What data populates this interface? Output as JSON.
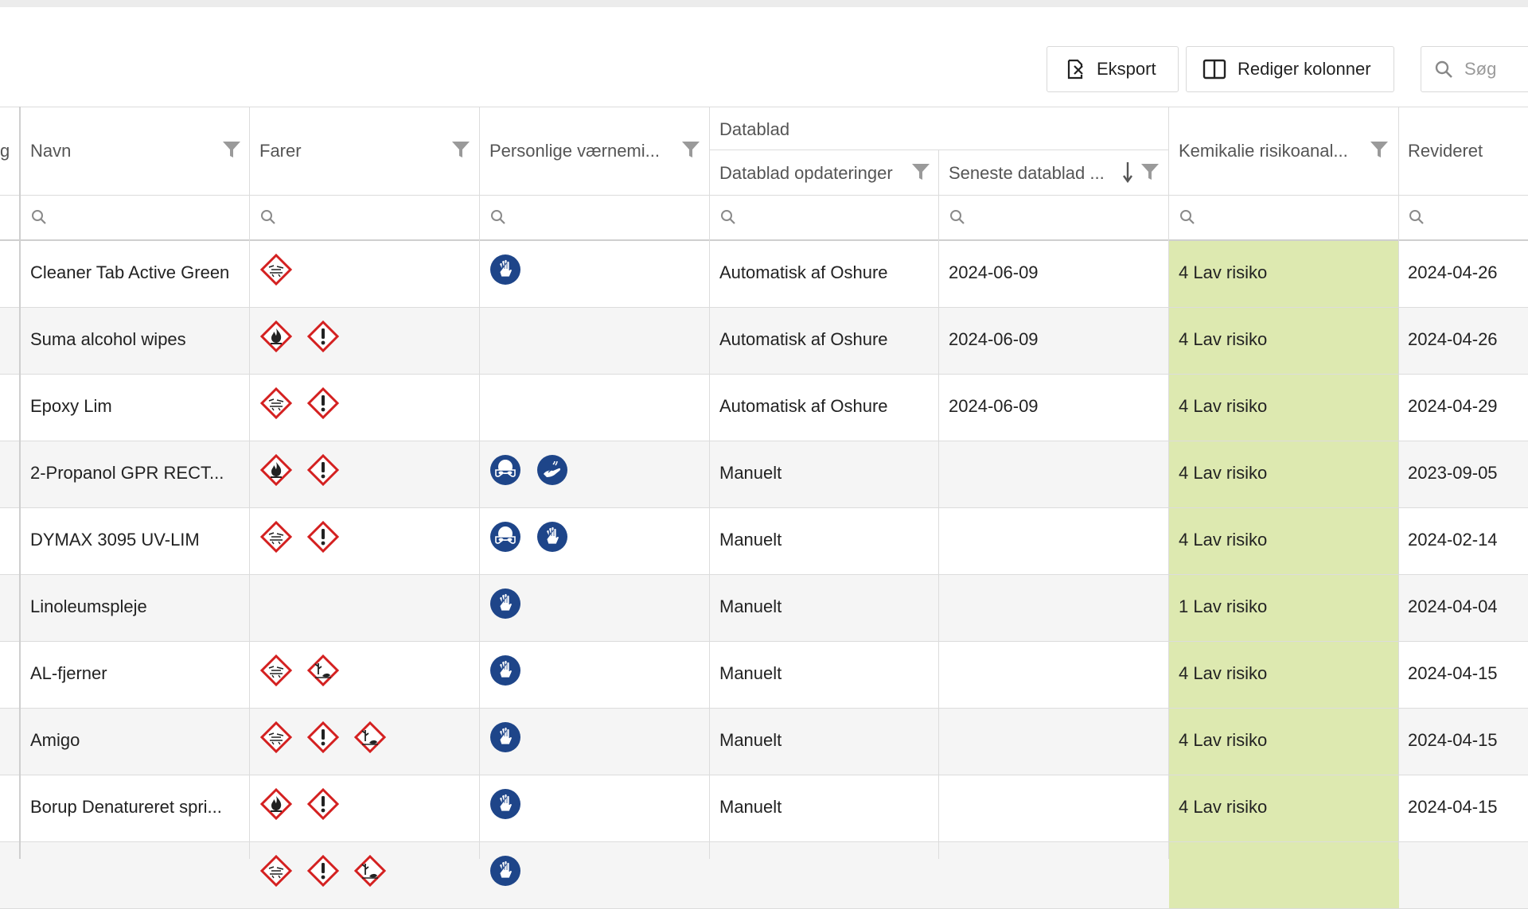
{
  "toolbar": {
    "export_label": "Eksport",
    "columns_label": "Rediger kolonner",
    "search_placeholder": "Søg"
  },
  "columns": {
    "partial_label": "g",
    "name": "Navn",
    "hazards": "Farer",
    "ppe": "Personlige værnemi...",
    "datasheet_group": "Datablad",
    "datasheet_updates": "Datablad opdateringer",
    "latest_datasheet": "Seneste datablad ...",
    "risk": "Kemikalie risikoanal...",
    "revised": "Revideret"
  },
  "colors": {
    "risk_bg": "#dde9b0",
    "hazard_red": "#d42020",
    "ppe_blue": "#1e4589"
  },
  "rows": [
    {
      "name": "Cleaner Tab Active Green",
      "hazards": [
        "corrosive-icon"
      ],
      "ppe": [
        "gloves-icon"
      ],
      "updates": "Automatisk af Oshure",
      "latest": "2024-06-09",
      "risk": "4 Lav risiko",
      "revised": "2024-04-26"
    },
    {
      "name": "Suma alcohol wipes",
      "hazards": [
        "flammable-icon",
        "exclamation-icon"
      ],
      "ppe": [],
      "updates": "Automatisk af Oshure",
      "latest": "2024-06-09",
      "risk": "4 Lav risiko",
      "revised": "2024-04-26"
    },
    {
      "name": "Epoxy Lim",
      "hazards": [
        "corrosive-icon",
        "exclamation-icon"
      ],
      "ppe": [],
      "updates": "Automatisk af Oshure",
      "latest": "2024-06-09",
      "risk": "4 Lav risiko",
      "revised": "2024-04-29"
    },
    {
      "name": "2-Propanol GPR RECT...",
      "hazards": [
        "flammable-icon",
        "exclamation-icon"
      ],
      "ppe": [
        "goggles-icon",
        "hand-wash-icon"
      ],
      "updates": "Manuelt",
      "latest": "",
      "risk": "4 Lav risiko",
      "revised": "2023-09-05"
    },
    {
      "name": "DYMAX 3095 UV-LIM",
      "hazards": [
        "corrosive-icon",
        "exclamation-icon"
      ],
      "ppe": [
        "goggles-icon",
        "gloves-icon"
      ],
      "updates": "Manuelt",
      "latest": "",
      "risk": "4 Lav risiko",
      "revised": "2024-02-14"
    },
    {
      "name": "Linoleumspleje",
      "hazards": [],
      "ppe": [
        "gloves-icon"
      ],
      "updates": "Manuelt",
      "latest": "",
      "risk": "1 Lav risiko",
      "revised": "2024-04-04"
    },
    {
      "name": "AL-fjerner",
      "hazards": [
        "corrosive-icon",
        "environment-icon"
      ],
      "ppe": [
        "gloves-icon"
      ],
      "updates": "Manuelt",
      "latest": "",
      "risk": "4 Lav risiko",
      "revised": "2024-04-15"
    },
    {
      "name": "Amigo",
      "hazards": [
        "corrosive-icon",
        "exclamation-icon",
        "environment-icon"
      ],
      "ppe": [
        "gloves-icon"
      ],
      "updates": "Manuelt",
      "latest": "",
      "risk": "4 Lav risiko",
      "revised": "2024-04-15"
    },
    {
      "name": "Borup Denatureret spri...",
      "hazards": [
        "flammable-icon",
        "exclamation-icon"
      ],
      "ppe": [
        "gloves-icon"
      ],
      "updates": "Manuelt",
      "latest": "",
      "risk": "4 Lav risiko",
      "revised": "2024-04-15"
    },
    {
      "name": "",
      "hazards": [
        "corrosive-icon",
        "exclamation-icon",
        "environment-icon"
      ],
      "ppe": [
        "gloves-icon"
      ],
      "updates": "",
      "latest": "",
      "risk": "",
      "revised": ""
    }
  ]
}
